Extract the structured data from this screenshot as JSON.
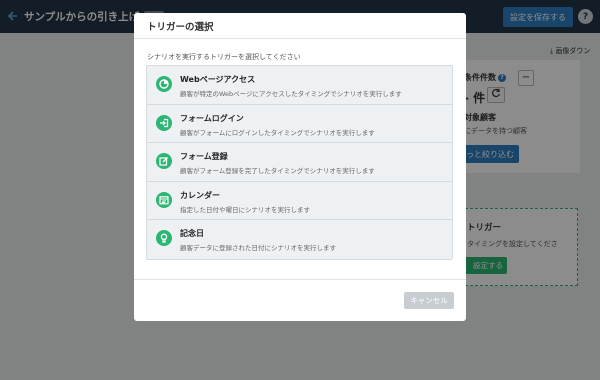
{
  "app": {
    "title": "サンプルからの引き上げ",
    "badge": "下書",
    "save_label": "設定を保存する",
    "help_label": "?"
  },
  "background": {
    "download_label": "⤓ 画像ダウン",
    "stat_label": "条件件数",
    "stat_help": "?",
    "stat_value": "- 件",
    "refresh_icon": "refresh-icon",
    "minus_label": "−",
    "target_label": "対象顧客",
    "target_desc": "にデータを持つ顧客",
    "narrow_label": "っと絞り込む",
    "trigger_title": "トリガー",
    "trigger_desc": "タイミングを設定してくださ",
    "trigger_set_label": "設定する"
  },
  "modal": {
    "title": "トリガーの選択",
    "instruction": "シナリオを実行するトリガーを選択してください",
    "options": [
      {
        "title": "Webページアクセス",
        "desc": "顧客が特定のWebページにアクセスしたタイミングでシナリオを実行します",
        "icon": "pie-icon"
      },
      {
        "title": "フォームログイン",
        "desc": "顧客がフォームにログインしたタイミングでシナリオを実行します",
        "icon": "login-icon"
      },
      {
        "title": "フォーム登録",
        "desc": "顧客がフォーム登録を完了したタイミングでシナリオを実行します",
        "icon": "edit-icon"
      },
      {
        "title": "カレンダー",
        "desc": "指定した日付や曜日にシナリオを実行します",
        "icon": "calendar-icon"
      },
      {
        "title": "記念日",
        "desc": "顧客データに登録された日付にシナリオを実行します",
        "icon": "anniversary-icon"
      }
    ],
    "cancel_label": "キャンセル"
  },
  "colors": {
    "topbar": "#243547",
    "primary": "#2f7fc1",
    "accent": "#2bb673",
    "cancel": "#c8cdd2"
  }
}
